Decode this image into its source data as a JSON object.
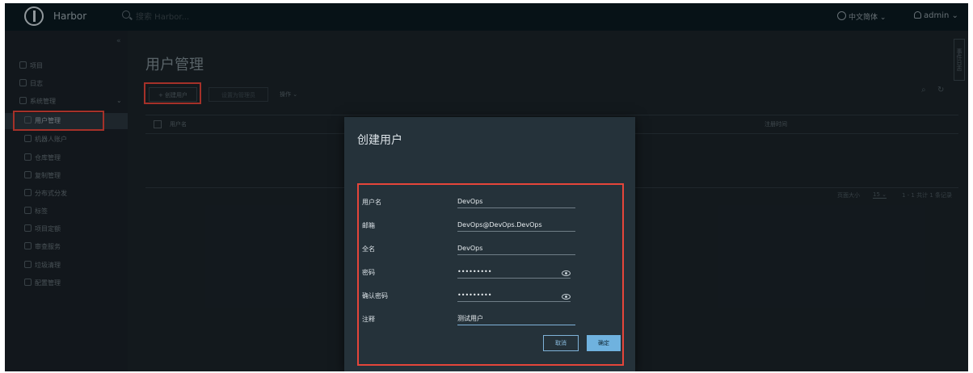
{
  "header": {
    "brand": "Harbor",
    "search_placeholder": "搜索 Harbor...",
    "language": "中文简体",
    "user": "admin"
  },
  "sidebar": {
    "items": [
      {
        "label": "项目"
      },
      {
        "label": "日志"
      },
      {
        "label": "系统管理"
      }
    ],
    "sub_items": [
      {
        "label": "用户管理"
      },
      {
        "label": "机器人账户"
      },
      {
        "label": "仓库管理"
      },
      {
        "label": "复制管理"
      },
      {
        "label": "分布式分发"
      },
      {
        "label": "标签"
      },
      {
        "label": "项目定额"
      },
      {
        "label": "审查服务"
      },
      {
        "label": "垃圾清理"
      },
      {
        "label": "配置管理"
      }
    ]
  },
  "main": {
    "title": "用户管理",
    "btn_new_user": "+ 创建用户",
    "btn_set_admin": "设置为管理员",
    "btn_action": "操作",
    "columns": [
      "用户名",
      "注册时间"
    ],
    "page_size_label": "页面大小",
    "page_size": "15",
    "pagination": "1 - 1 共计 1 条记录",
    "right_tab": "事件日志"
  },
  "modal": {
    "title": "创建用户",
    "fields": {
      "username": {
        "label": "用户名",
        "value": "DevOps"
      },
      "email": {
        "label": "邮箱",
        "value": "DevOps@DevOps.DevOps"
      },
      "fullname": {
        "label": "全名",
        "value": "DevOps"
      },
      "password": {
        "label": "密码",
        "value": "•••••••••"
      },
      "confirm": {
        "label": "确认密码",
        "value": "•••••••••"
      },
      "comment": {
        "label": "注释",
        "value": "测试用户"
      }
    },
    "cancel": "取消",
    "ok": "确定"
  },
  "colors": {
    "highlight": "#e5453a",
    "primary": "#6fb2df",
    "background": "#1b2329"
  }
}
